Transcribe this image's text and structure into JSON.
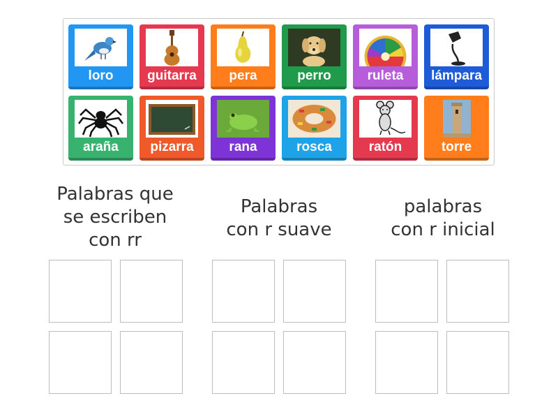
{
  "tiles": [
    {
      "label": "loro",
      "icon": "parrot-icon",
      "color": "#2196f3"
    },
    {
      "label": "guitarra",
      "icon": "guitar-icon",
      "color": "#e53950"
    },
    {
      "label": "pera",
      "icon": "pear-icon",
      "color": "#ff7d1a"
    },
    {
      "label": "perro",
      "icon": "dog-icon",
      "color": "#1f9b4b"
    },
    {
      "label": "ruleta",
      "icon": "roulette-wheel-icon",
      "color": "#b75cdb"
    },
    {
      "label": "lámpara",
      "icon": "lamp-icon",
      "color": "#1e5bd6"
    },
    {
      "label": "araña",
      "icon": "spider-icon",
      "color": "#37b36f"
    },
    {
      "label": "pizarra",
      "icon": "chalkboard-icon",
      "color": "#f0592a"
    },
    {
      "label": "rana",
      "icon": "frog-icon",
      "color": "#7e33d6"
    },
    {
      "label": "rosca",
      "icon": "rosca-cake-icon",
      "color": "#1fa3e8"
    },
    {
      "label": "ratón",
      "icon": "mouse-icon",
      "color": "#e53950"
    },
    {
      "label": "torre",
      "icon": "tower-icon",
      "color": "#ff7d1a"
    }
  ],
  "groups": [
    {
      "heading": "Palabras que\nse escriben\ncon rr"
    },
    {
      "heading": "Palabras\ncon r suave"
    },
    {
      "heading": "palabras\ncon r inicial"
    }
  ]
}
